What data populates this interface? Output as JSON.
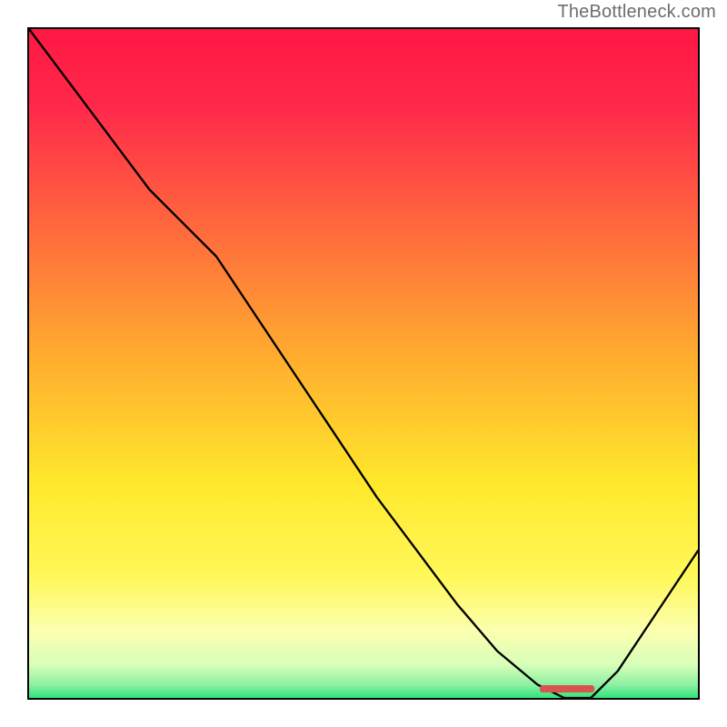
{
  "attribution": "TheBottleneck.com",
  "chart_data": {
    "type": "line",
    "title": "",
    "xlabel": "",
    "ylabel": "",
    "xlim": [
      0,
      100
    ],
    "ylim": [
      0,
      100
    ],
    "x": [
      0,
      6,
      12,
      18,
      24,
      28,
      34,
      40,
      46,
      52,
      58,
      64,
      70,
      76,
      80,
      84,
      88,
      92,
      96,
      100
    ],
    "values": [
      100,
      92,
      84,
      76,
      70,
      66,
      57,
      48,
      39,
      30,
      22,
      14,
      7,
      2,
      0,
      0,
      4,
      10,
      16,
      22
    ],
    "background_gradient": {
      "stops": [
        {
          "pos": 0.0,
          "color": "#ff1744"
        },
        {
          "pos": 0.5,
          "color": "#ffb02e"
        },
        {
          "pos": 0.82,
          "color": "#fff85a"
        },
        {
          "pos": 1.0,
          "color": "#2ee57a"
        }
      ]
    },
    "optimal_range_x": [
      76,
      84
    ],
    "marker_color": "#d9534f"
  }
}
